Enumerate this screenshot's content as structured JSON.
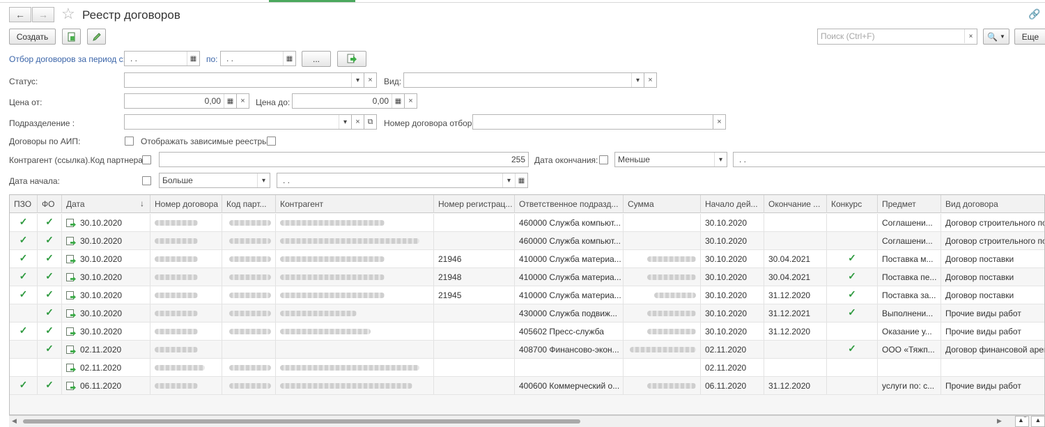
{
  "window": {
    "title": "Реестр договоров"
  },
  "toolbar": {
    "create_label": "Создать",
    "more_label": "Еще",
    "search_placeholder": "Поиск (Ctrl+F)"
  },
  "filters": {
    "period_from_label": "Отбор договоров за период с:",
    "period_to_label": "по:",
    "date_empty": " .  .",
    "dots_label": "...",
    "status_label": "Статус:",
    "kind_label": "Вид:",
    "price_from_label": "Цена от:",
    "price_from_value": "0,00",
    "price_to_label": "Цена до:",
    "price_to_value": "0,00",
    "department_label": "Подразделение :",
    "contract_number_label": "Номер договора отбор:",
    "aip_label": "Договоры по АИП:",
    "dependent_label": "Отображать зависимые реестры:",
    "partner_code_label": "Контрагент (ссылка).Код партнера:",
    "partner_code_value": "255",
    "end_date_label": "Дата окончания:",
    "end_date_cmp": "Меньше",
    "start_date_label": "Дата начала:",
    "start_date_cmp": "Больше"
  },
  "table": {
    "columns": [
      "ПЗО",
      "ФО",
      "Дата",
      "Номер договора",
      "Код парт...",
      "Контрагент",
      "Номер регистрац...",
      "Ответственное подразд...",
      "Сумма",
      "Начало дей...",
      "Окончание ...",
      "Конкурс",
      "Предмет",
      "Вид договора"
    ],
    "sort_indicator": "↓",
    "rows": [
      {
        "pzo": true,
        "fo": true,
        "date": "30.10.2020",
        "reg": "",
        "dept": "460000 Служба компьют...",
        "start": "30.10.2020",
        "end": "",
        "contest": false,
        "subject": "Соглашени...",
        "kind": "Договор строительного под"
      },
      {
        "pzo": true,
        "fo": true,
        "date": "30.10.2020",
        "reg": "",
        "dept": "460000 Служба компьют...",
        "start": "30.10.2020",
        "end": "",
        "contest": false,
        "subject": " Соглашени...",
        "kind": "Договор строительного под"
      },
      {
        "pzo": true,
        "fo": true,
        "date": "30.10.2020",
        "reg": "21946",
        "dept": "410000 Служба материа...",
        "start": "30.10.2020",
        "end": "30.04.2021",
        "contest": true,
        "subject": "Поставка м...",
        "kind": "Договор поставки"
      },
      {
        "pzo": true,
        "fo": true,
        "date": "30.10.2020",
        "reg": "21948",
        "dept": "410000 Служба материа...",
        "start": "30.10.2020",
        "end": "30.04.2021",
        "contest": true,
        "subject": "Поставка пе...",
        "kind": "Договор поставки"
      },
      {
        "pzo": true,
        "fo": true,
        "date": "30.10.2020",
        "reg": "21945",
        "dept": "410000 Служба материа...",
        "start": "30.10.2020",
        "end": "31.12.2020",
        "contest": true,
        "subject": "Поставка за...",
        "kind": "Договор поставки"
      },
      {
        "pzo": false,
        "fo": true,
        "date": "30.10.2020",
        "reg": "",
        "dept": "430000 Служба подвиж...",
        "start": "30.10.2020",
        "end": "31.12.2021",
        "contest": true,
        "subject": " Выполнени...",
        "kind": "Прочие виды работ"
      },
      {
        "pzo": true,
        "fo": true,
        "date": "30.10.2020",
        "reg": "",
        "dept": "405602 Пресс-служба",
        "start": "30.10.2020",
        "end": "31.12.2020",
        "contest": false,
        "subject": "Оказание у...",
        "kind": "Прочие виды работ"
      },
      {
        "pzo": false,
        "fo": true,
        "date": "02.11.2020",
        "reg": "",
        "dept": "408700 Финансово-экон...",
        "start": "02.11.2020",
        "end": "",
        "contest": true,
        "subject": "ООО «Тяжп...",
        "kind": "Договор финансовой аренд"
      },
      {
        "pzo": false,
        "fo": false,
        "date": "02.11.2020",
        "reg": "",
        "dept": "",
        "start": "02.11.2020",
        "end": "",
        "contest": false,
        "subject": "",
        "kind": ""
      },
      {
        "pzo": true,
        "fo": true,
        "date": "06.11.2020",
        "reg": "",
        "dept": "400600 Коммерческий о...",
        "start": "06.11.2020",
        "end": "31.12.2020",
        "contest": false,
        "subject": "услуги по: с...",
        "kind": "Прочие виды работ"
      }
    ]
  },
  "colors": {
    "check": "#2e9a3f",
    "link_label": "#3a64a8"
  }
}
